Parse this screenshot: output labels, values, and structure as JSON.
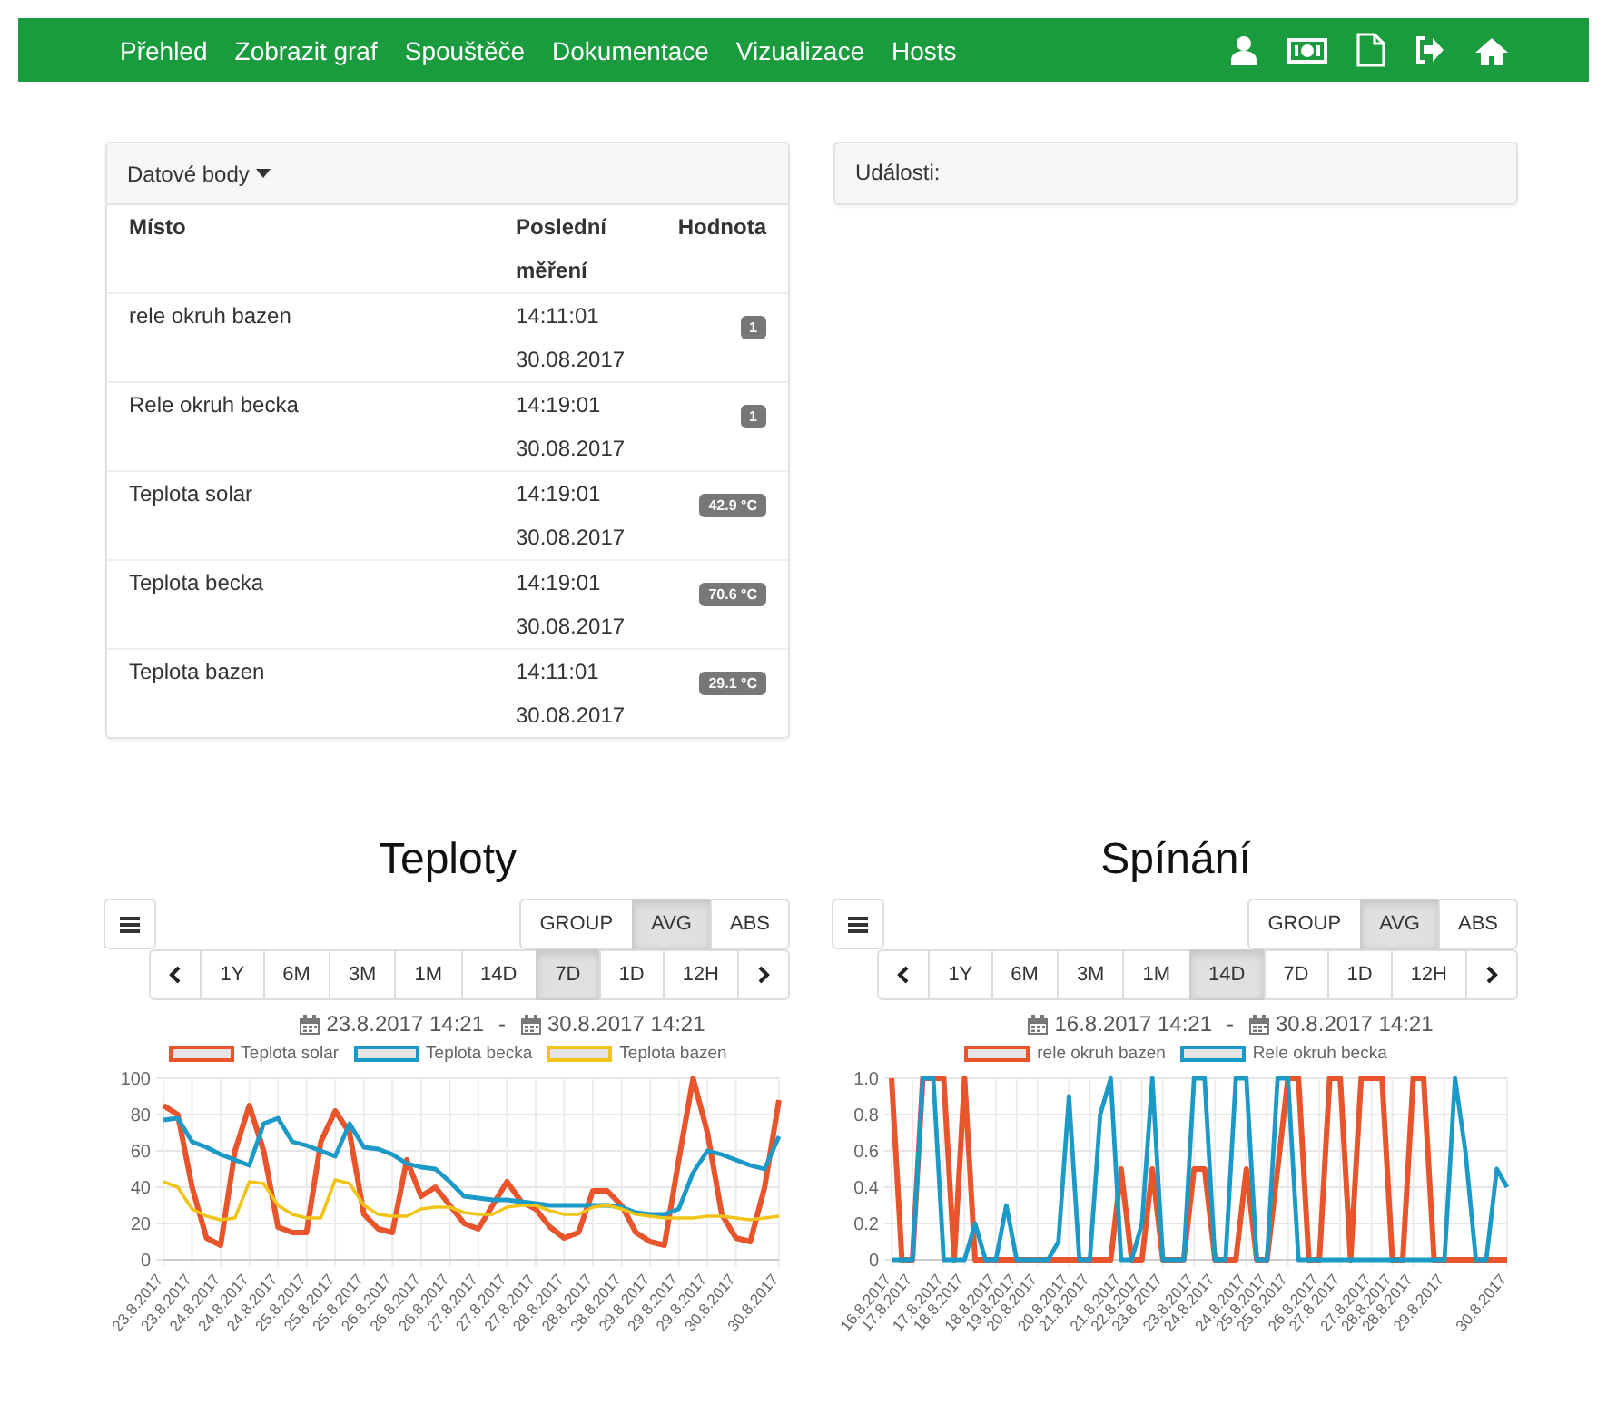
{
  "nav": {
    "links": [
      "Přehled",
      "Zobrazit graf",
      "Spouštěče",
      "Dokumentace",
      "Vizualizace",
      "Hosts"
    ]
  },
  "datapoints": {
    "title": "Datové body",
    "columns": [
      "Místo",
      "Poslední měření",
      "Hodnota"
    ],
    "rows": [
      {
        "place": "rele okruh bazen",
        "measured": "14:11:01 30.08.2017",
        "value": "1"
      },
      {
        "place": "Rele okruh becka",
        "measured": "14:19:01 30.08.2017",
        "value": "1"
      },
      {
        "place": "Teplota solar",
        "measured": "14:19:01 30.08.2017",
        "value": "42.9 °C"
      },
      {
        "place": "Teplota becka",
        "measured": "14:19:01 30.08.2017",
        "value": "70.6 °C"
      },
      {
        "place": "Teplota bazen",
        "measured": "14:11:01 30.08.2017",
        "value": "29.1 °C"
      }
    ]
  },
  "events": {
    "title": "Události:"
  },
  "charts": [
    {
      "title": "Teploty",
      "modes": [
        {
          "label": "GROUP",
          "selected": false
        },
        {
          "label": "AVG",
          "selected": true
        },
        {
          "label": "ABS",
          "selected": false
        }
      ],
      "ranges": [
        {
          "label": "1Y",
          "selected": false
        },
        {
          "label": "6M",
          "selected": false
        },
        {
          "label": "3M",
          "selected": false
        },
        {
          "label": "1M",
          "selected": false
        },
        {
          "label": "14D",
          "selected": false
        },
        {
          "label": "7D",
          "selected": true
        },
        {
          "label": "1D",
          "selected": false
        },
        {
          "label": "12H",
          "selected": false
        }
      ],
      "from": "23.8.2017 14:21",
      "separator": "-",
      "to": "30.8.2017 14:21",
      "chart_data": {
        "type": "line",
        "grid": true,
        "ylim": [
          0,
          100
        ],
        "yticks": [
          0,
          20,
          40,
          60,
          80,
          100
        ],
        "categories": [
          "23.8.2017",
          null,
          "23.8.2017",
          null,
          "24.8.2017",
          null,
          "24.8.2017",
          null,
          "24.8.2017",
          null,
          "25.8.2017",
          null,
          "25.8.2017",
          null,
          "25.8.2017",
          null,
          "26.8.2017",
          null,
          "26.8.2017",
          null,
          "26.8.2017",
          null,
          "27.8.2017",
          null,
          "27.8.2017",
          null,
          "27.8.2017",
          null,
          "28.8.2017",
          null,
          "28.8.2017",
          null,
          "28.8.2017",
          null,
          "29.8.2017",
          null,
          "29.8.2017",
          null,
          "29.8.2017",
          null,
          "30.8.2017",
          null,
          null,
          "30.8.2017"
        ],
        "series": [
          {
            "name": "Teplota solar",
            "color": "#e8542b",
            "values": [
              85,
              80,
              40,
              12,
              8,
              60,
              85,
              60,
              18,
              15,
              15,
              65,
              82,
              70,
              25,
              17,
              15,
              55,
              35,
              40,
              30,
              20,
              17,
              30,
              43,
              32,
              28,
              18,
              12,
              15,
              38,
              38,
              30,
              15,
              10,
              8,
              55,
              100,
              70,
              25,
              12,
              10,
              40,
              88
            ]
          },
          {
            "name": "Teplota becka",
            "color": "#1b9ac8",
            "values": [
              77,
              78,
              65,
              62,
              58,
              55,
              52,
              75,
              78,
              65,
              63,
              60,
              57,
              75,
              62,
              61,
              58,
              53,
              51,
              50,
              43,
              35,
              34,
              33,
              33,
              32,
              31,
              30,
              30,
              30,
              30,
              30,
              29,
              26,
              25,
              25,
              28,
              48,
              60,
              58,
              55,
              52,
              50,
              68
            ]
          },
          {
            "name": "Teplota bazen",
            "color": "#f0c419",
            "values": [
              43,
              40,
              28,
              24,
              22,
              23,
              43,
              42,
              30,
              25,
              23,
              23,
              44,
              42,
              30,
              25,
              24,
              24,
              28,
              29,
              29,
              26,
              25,
              25,
              29,
              30,
              30,
              27,
              25,
              25,
              29,
              30,
              28,
              25,
              24,
              23,
              23,
              23,
              24,
              24,
              23,
              22,
              23,
              24
            ]
          }
        ]
      }
    },
    {
      "title": "Spínání",
      "modes": [
        {
          "label": "GROUP",
          "selected": false
        },
        {
          "label": "AVG",
          "selected": true
        },
        {
          "label": "ABS",
          "selected": false
        }
      ],
      "ranges": [
        {
          "label": "1Y",
          "selected": false
        },
        {
          "label": "6M",
          "selected": false
        },
        {
          "label": "3M",
          "selected": false
        },
        {
          "label": "1M",
          "selected": false
        },
        {
          "label": "14D",
          "selected": true
        },
        {
          "label": "7D",
          "selected": false
        },
        {
          "label": "1D",
          "selected": false
        },
        {
          "label": "12H",
          "selected": false
        }
      ],
      "from": "16.8.2017 14:21",
      "separator": "-",
      "to": "30.8.2017 14:21",
      "chart_data": {
        "type": "line",
        "grid": true,
        "ylim": [
          0,
          1
        ],
        "yticks": [
          {
            "value": 0,
            "label": "0"
          },
          {
            "value": 0.2,
            "label": "0.2"
          },
          {
            "value": 0.4,
            "label": "0.4"
          },
          {
            "value": 0.6,
            "label": "0.6"
          },
          {
            "value": 0.8,
            "label": "0.8"
          },
          {
            "value": 1,
            "label": "1.0"
          }
        ],
        "categories": [
          "16.8.2017",
          null,
          "17.8.2017",
          null,
          null,
          "17.8.2017",
          null,
          "18.8.2017",
          null,
          null,
          "18.8.2017",
          null,
          "19.8.2017",
          null,
          "20.8.2017",
          null,
          null,
          "20.8.2017",
          null,
          "21.8.2017",
          null,
          null,
          "21.8.2017",
          null,
          "22.8.2017",
          null,
          "23.8.2017",
          null,
          null,
          "23.8.2017",
          null,
          "24.8.2017",
          null,
          null,
          "24.8.2017",
          null,
          "25.8.2017",
          null,
          "25.8.2017",
          null,
          null,
          "26.8.2017",
          null,
          "27.8.2017",
          null,
          null,
          "27.8.2017",
          null,
          "28.8.2017",
          null,
          "28.8.2017",
          null,
          null,
          "29.8.2017",
          null,
          null,
          null,
          null,
          null,
          "30.8.2017"
        ],
        "series": [
          {
            "name": "rele okruh bazen",
            "color": "#e8542b",
            "values": [
              1,
              0,
              0,
              1,
              1,
              1,
              0,
              1,
              0,
              0,
              0,
              0,
              0,
              0,
              0,
              0,
              0,
              0,
              0,
              0,
              0,
              0,
              0.5,
              0,
              0,
              0.5,
              0,
              0,
              0,
              0.5,
              0.5,
              0,
              0,
              0,
              0.5,
              0,
              0,
              0.5,
              1,
              1,
              0,
              0,
              1,
              1,
              0,
              1,
              1,
              1,
              0,
              0,
              1,
              1,
              0,
              0,
              0,
              0,
              0,
              0,
              0,
              0
            ]
          },
          {
            "name": "Rele okruh becka",
            "color": "#1b9ac8",
            "values": [
              0,
              0,
              0,
              1,
              1,
              0,
              0,
              0,
              0.2,
              0,
              0,
              0.3,
              0,
              0,
              0,
              0,
              0.1,
              0.9,
              0,
              0,
              0.8,
              1,
              0,
              0,
              0.2,
              1,
              0,
              0,
              0,
              1,
              1,
              0,
              0,
              1,
              1,
              0,
              0,
              1,
              1,
              0,
              0,
              0,
              0,
              0,
              0,
              0,
              0,
              0,
              0,
              0,
              0,
              0,
              0,
              0,
              1,
              0.6,
              0,
              0,
              0.5,
              0.4
            ]
          }
        ]
      }
    }
  ]
}
